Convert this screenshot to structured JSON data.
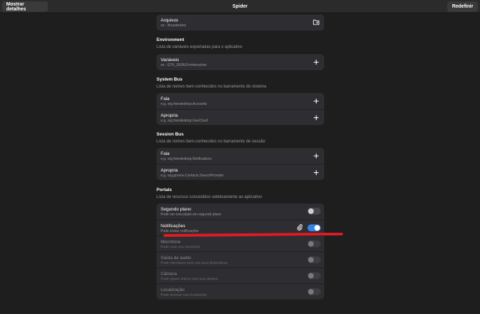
{
  "header": {
    "title": "Spider",
    "left_button": "Mostrar detalhes",
    "right_button": "Redefinir"
  },
  "files_card": {
    "rows": [
      {
        "title": "Arquivos",
        "subtitle": "ex.: /thunderbird",
        "icon": "folder-add-icon"
      }
    ]
  },
  "environment": {
    "title": "Environment",
    "description": "Lista de variáveis exportadas para o aplicativo",
    "rows": [
      {
        "title": "Variáveis",
        "subtitle": "ex.: GTK_DEBUG=interactive",
        "icon": "plus-icon"
      }
    ]
  },
  "system_bus": {
    "title": "System Bus",
    "description": "Lista de nomes bem-conhecidos no barramento do sistema",
    "rows": [
      {
        "title": "Fala",
        "subtitle": "e.g. org.freedesktop.Accounts",
        "icon": "plus-icon"
      },
      {
        "title": "Apropria",
        "subtitle": "e.g. org.freedesktop.GeoClue2",
        "icon": "plus-icon"
      }
    ]
  },
  "session_bus": {
    "title": "Session Bus",
    "description": "Lista de nomes bem-conhecidos no barramento de sessão",
    "rows": [
      {
        "title": "Fala",
        "subtitle": "e.g. org.freedesktop.Notifications",
        "icon": "plus-icon"
      },
      {
        "title": "Apropria",
        "subtitle": "e.g. org.gnome.Contacts.SearchProvider",
        "icon": "plus-icon"
      }
    ]
  },
  "portals": {
    "title": "Portals",
    "description": "Lista de recursos concedidos seletivamente ao aplicativo",
    "rows": [
      {
        "title": "Segundo plano",
        "subtitle": "Pode ser executado em segundo plano",
        "enabled": false,
        "dim": false
      },
      {
        "title": "Notificações",
        "subtitle": "Pode enviar notificações",
        "enabled": true,
        "dim": false,
        "icon": "paperclip-icon"
      },
      {
        "title": "Microfone",
        "subtitle": "Pode ouvir seu microfone",
        "enabled": false,
        "dim": true
      },
      {
        "title": "Saída de áudio",
        "subtitle": "Pode reproduzir sons nos seus dispositivos",
        "enabled": false,
        "dim": true
      },
      {
        "title": "Câmera",
        "subtitle": "Pode gravar vídeos com sua câmera",
        "enabled": false,
        "dim": true
      },
      {
        "title": "Localização",
        "subtitle": "Pode acessar sua localização",
        "enabled": false,
        "dim": true
      }
    ]
  },
  "colors": {
    "accent": "#3584e4",
    "annotation": "#e01b24"
  }
}
